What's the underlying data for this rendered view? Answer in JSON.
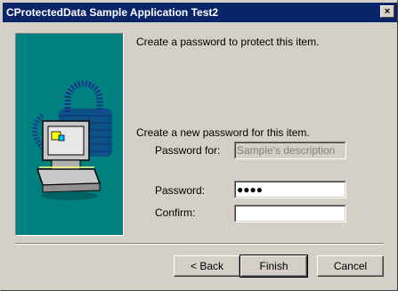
{
  "window": {
    "title": "CProtectedData Sample Application Test2",
    "close_glyph": "×"
  },
  "intro_text": "Create a password to protect this item.",
  "form": {
    "heading": "Create a new password for this item.",
    "password_for_label": "Password for:",
    "password_for_value": "Sample's description",
    "password_label": "Password:",
    "password_value": "●●●●",
    "confirm_label": "Confirm:",
    "confirm_value": ""
  },
  "buttons": {
    "back": "< Back",
    "finish": "Finish",
    "cancel": "Cancel"
  },
  "colors": {
    "titlebar": "#0a246a",
    "art_background": "#008080",
    "dialog_background": "#d4d0c8"
  },
  "icons": {
    "wizard_art": "computer-with-padlock"
  }
}
